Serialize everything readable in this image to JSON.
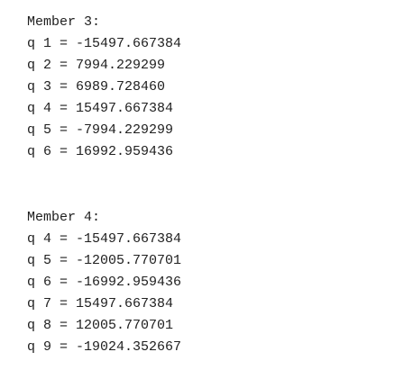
{
  "console": {
    "member3": {
      "header": "Member 3:",
      "lines": [
        "q 1 = -15497.667384",
        "q 2 = 7994.229299",
        "q 3 = 6989.728460",
        "q 4 = 15497.667384",
        "q 5 = -7994.229299",
        "q 6 = 16992.959436"
      ]
    },
    "member4": {
      "header": "Member 4:",
      "lines": [
        "q 4 = -15497.667384",
        "q 5 = -12005.770701",
        "q 6 = -16992.959436",
        "q 7 = 15497.667384",
        "q 8 = 12005.770701",
        "q 9 = -19024.352667"
      ]
    }
  }
}
